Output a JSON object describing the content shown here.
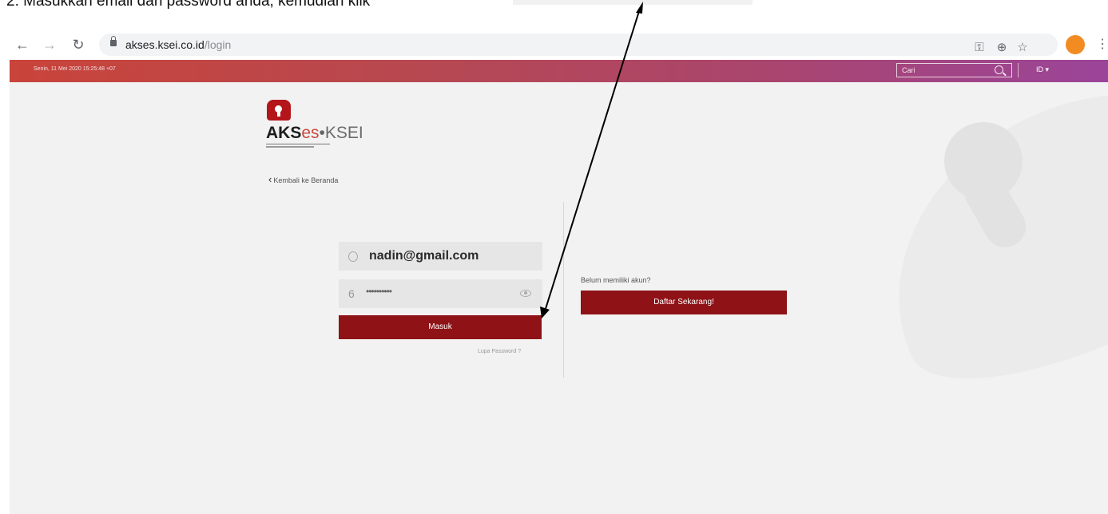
{
  "instruction": {
    "text": "2. Masukkan email dan password anda, kemudian klik"
  },
  "browser": {
    "url_host": "akses.ksei.co.id",
    "url_path": "/login",
    "back_glyph": "←",
    "forward_glyph": "→",
    "reload_glyph": "↻",
    "key_glyph": "⚿",
    "zoom_glyph": "⊕",
    "star_glyph": "☆",
    "menu_glyph": "⋮"
  },
  "header": {
    "datetime": "Senin, 11 Mei 2020 15:25:48 +07",
    "search_placeholder": "Cari",
    "language": "ID ▾"
  },
  "logo": {
    "part1": "AKS",
    "part2": "es",
    "part3": "•",
    "part4": "KSEI"
  },
  "login": {
    "back_label": "Kembali ke Beranda",
    "email_value": "nadin@gmail.com",
    "password_mask": "••••••••••",
    "submit_label": "Masuk",
    "forgot_label": "Lupa Password ?"
  },
  "register": {
    "prompt": "Belum memiliki akun?",
    "button_label": "Daftar Sekarang!"
  },
  "colors": {
    "brand_red": "#8e1216",
    "header_gradient_start": "#c9443a",
    "header_gradient_end": "#9b459a",
    "profile": "#f28b21"
  }
}
